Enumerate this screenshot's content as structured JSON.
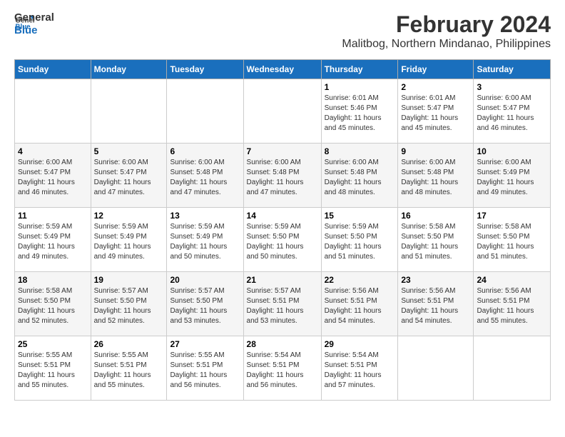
{
  "app": {
    "logo_line1": "General",
    "logo_line2": "Blue"
  },
  "title": "February 2024",
  "subtitle": "Malitbog, Northern Mindanao, Philippines",
  "headers": [
    "Sunday",
    "Monday",
    "Tuesday",
    "Wednesday",
    "Thursday",
    "Friday",
    "Saturday"
  ],
  "weeks": [
    [
      {
        "num": "",
        "info": ""
      },
      {
        "num": "",
        "info": ""
      },
      {
        "num": "",
        "info": ""
      },
      {
        "num": "",
        "info": ""
      },
      {
        "num": "1",
        "info": "Sunrise: 6:01 AM\nSunset: 5:46 PM\nDaylight: 11 hours\nand 45 minutes."
      },
      {
        "num": "2",
        "info": "Sunrise: 6:01 AM\nSunset: 5:47 PM\nDaylight: 11 hours\nand 45 minutes."
      },
      {
        "num": "3",
        "info": "Sunrise: 6:00 AM\nSunset: 5:47 PM\nDaylight: 11 hours\nand 46 minutes."
      }
    ],
    [
      {
        "num": "4",
        "info": "Sunrise: 6:00 AM\nSunset: 5:47 PM\nDaylight: 11 hours\nand 46 minutes."
      },
      {
        "num": "5",
        "info": "Sunrise: 6:00 AM\nSunset: 5:47 PM\nDaylight: 11 hours\nand 47 minutes."
      },
      {
        "num": "6",
        "info": "Sunrise: 6:00 AM\nSunset: 5:48 PM\nDaylight: 11 hours\nand 47 minutes."
      },
      {
        "num": "7",
        "info": "Sunrise: 6:00 AM\nSunset: 5:48 PM\nDaylight: 11 hours\nand 47 minutes."
      },
      {
        "num": "8",
        "info": "Sunrise: 6:00 AM\nSunset: 5:48 PM\nDaylight: 11 hours\nand 48 minutes."
      },
      {
        "num": "9",
        "info": "Sunrise: 6:00 AM\nSunset: 5:48 PM\nDaylight: 11 hours\nand 48 minutes."
      },
      {
        "num": "10",
        "info": "Sunrise: 6:00 AM\nSunset: 5:49 PM\nDaylight: 11 hours\nand 49 minutes."
      }
    ],
    [
      {
        "num": "11",
        "info": "Sunrise: 5:59 AM\nSunset: 5:49 PM\nDaylight: 11 hours\nand 49 minutes."
      },
      {
        "num": "12",
        "info": "Sunrise: 5:59 AM\nSunset: 5:49 PM\nDaylight: 11 hours\nand 49 minutes."
      },
      {
        "num": "13",
        "info": "Sunrise: 5:59 AM\nSunset: 5:49 PM\nDaylight: 11 hours\nand 50 minutes."
      },
      {
        "num": "14",
        "info": "Sunrise: 5:59 AM\nSunset: 5:50 PM\nDaylight: 11 hours\nand 50 minutes."
      },
      {
        "num": "15",
        "info": "Sunrise: 5:59 AM\nSunset: 5:50 PM\nDaylight: 11 hours\nand 51 minutes."
      },
      {
        "num": "16",
        "info": "Sunrise: 5:58 AM\nSunset: 5:50 PM\nDaylight: 11 hours\nand 51 minutes."
      },
      {
        "num": "17",
        "info": "Sunrise: 5:58 AM\nSunset: 5:50 PM\nDaylight: 11 hours\nand 51 minutes."
      }
    ],
    [
      {
        "num": "18",
        "info": "Sunrise: 5:58 AM\nSunset: 5:50 PM\nDaylight: 11 hours\nand 52 minutes."
      },
      {
        "num": "19",
        "info": "Sunrise: 5:57 AM\nSunset: 5:50 PM\nDaylight: 11 hours\nand 52 minutes."
      },
      {
        "num": "20",
        "info": "Sunrise: 5:57 AM\nSunset: 5:50 PM\nDaylight: 11 hours\nand 53 minutes."
      },
      {
        "num": "21",
        "info": "Sunrise: 5:57 AM\nSunset: 5:51 PM\nDaylight: 11 hours\nand 53 minutes."
      },
      {
        "num": "22",
        "info": "Sunrise: 5:56 AM\nSunset: 5:51 PM\nDaylight: 11 hours\nand 54 minutes."
      },
      {
        "num": "23",
        "info": "Sunrise: 5:56 AM\nSunset: 5:51 PM\nDaylight: 11 hours\nand 54 minutes."
      },
      {
        "num": "24",
        "info": "Sunrise: 5:56 AM\nSunset: 5:51 PM\nDaylight: 11 hours\nand 55 minutes."
      }
    ],
    [
      {
        "num": "25",
        "info": "Sunrise: 5:55 AM\nSunset: 5:51 PM\nDaylight: 11 hours\nand 55 minutes."
      },
      {
        "num": "26",
        "info": "Sunrise: 5:55 AM\nSunset: 5:51 PM\nDaylight: 11 hours\nand 55 minutes."
      },
      {
        "num": "27",
        "info": "Sunrise: 5:55 AM\nSunset: 5:51 PM\nDaylight: 11 hours\nand 56 minutes."
      },
      {
        "num": "28",
        "info": "Sunrise: 5:54 AM\nSunset: 5:51 PM\nDaylight: 11 hours\nand 56 minutes."
      },
      {
        "num": "29",
        "info": "Sunrise: 5:54 AM\nSunset: 5:51 PM\nDaylight: 11 hours\nand 57 minutes."
      },
      {
        "num": "",
        "info": ""
      },
      {
        "num": "",
        "info": ""
      }
    ]
  ]
}
